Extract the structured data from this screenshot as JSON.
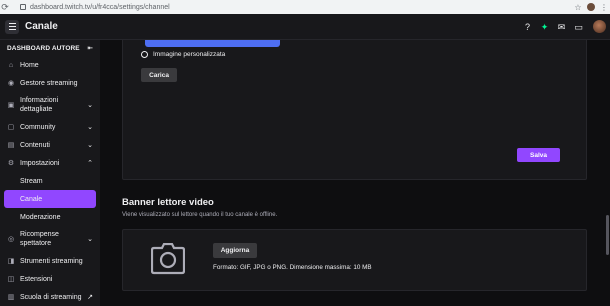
{
  "browser": {
    "url": "dashboard.twitch.tv/u/fr4cca/settings/channel"
  },
  "header": {
    "title": "Canale"
  },
  "sidebar": {
    "heading": "DASHBOARD AUTORE",
    "items": [
      {
        "label": "Home",
        "icon": "home-icon"
      },
      {
        "label": "Gestore streaming",
        "icon": "broadcast-icon"
      },
      {
        "label": "Informazioni dettagliate",
        "icon": "insights-icon",
        "expandable": true
      },
      {
        "label": "Community",
        "icon": "community-icon",
        "expandable": true
      },
      {
        "label": "Contenuti",
        "icon": "content-icon",
        "expandable": true
      },
      {
        "label": "Impostazioni",
        "icon": "gear-icon",
        "expanded": true
      },
      {
        "label": "Stream",
        "sub": true
      },
      {
        "label": "Canale",
        "sub": true,
        "active": true
      },
      {
        "label": "Moderazione",
        "sub": true
      },
      {
        "label": "Ricompense spettatore",
        "icon": "reward-icon",
        "expandable": true
      },
      {
        "label": "Strumenti streaming",
        "icon": "tools-icon"
      },
      {
        "label": "Estensioni",
        "icon": "extensions-icon"
      },
      {
        "label": "Scuola di streaming",
        "icon": "school-icon"
      }
    ]
  },
  "main": {
    "custom_image_label": "Immagine personalizzata",
    "upload_label": "Carica",
    "save_label": "Salva",
    "banner_title": "Banner lettore video",
    "banner_desc": "Viene visualizzato sul lettore quando il tuo canale è offline.",
    "update_label": "Aggiorna",
    "format_text": "Formato: GIF, JPG o PNG. Dimensione massima: 10 MB"
  },
  "colors": {
    "accent": "#9147ff",
    "background": "#0e0e10",
    "panel": "#18181b"
  }
}
